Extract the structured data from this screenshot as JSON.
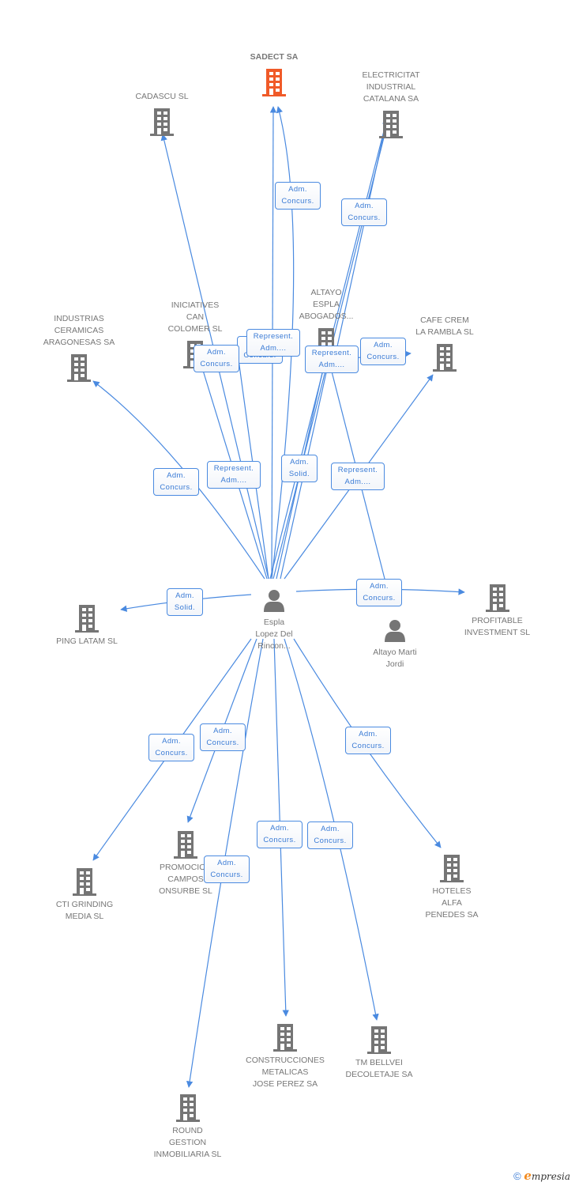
{
  "colors": {
    "edge": "#4a8ae0",
    "main_node": "#f05a28",
    "node": "#757575",
    "edge_text": "#3a7bd5",
    "text": "#777777"
  },
  "main_node": {
    "label": "SADECT SA",
    "icon": "building-icon"
  },
  "nodes": [
    {
      "id": "cadascu",
      "label": "CADASCU SL",
      "type": "company"
    },
    {
      "id": "electricitat",
      "label": "ELECTRICITAT\nINDUSTRIAL\nCATALANA SA",
      "type": "company"
    },
    {
      "id": "industrias",
      "label": "INDUSTRIAS\nCERAMICAS\nARAGONESAS SA",
      "type": "company"
    },
    {
      "id": "iniciatives",
      "label": "INICIATIVES\nCAN\nCOLOMER SL",
      "type": "company"
    },
    {
      "id": "altayo_espla",
      "label": "ALTAYO\nESPLA\nABOGADOS...",
      "type": "company"
    },
    {
      "id": "cafe_crem",
      "label": "CAFE CREM\nLA RAMBLA SL",
      "type": "company"
    },
    {
      "id": "ping_latam",
      "label": "PING LATAM SL",
      "type": "company"
    },
    {
      "id": "espla_lopez",
      "label": "Espla\nLopez Del\nRincon...",
      "type": "person"
    },
    {
      "id": "altayo_marti",
      "label": "Altayo Marti\nJordi",
      "type": "person"
    },
    {
      "id": "profitable",
      "label": "PROFITABLE\nINVESTMENT SL",
      "type": "company"
    },
    {
      "id": "cti",
      "label": "CTI GRINDING\nMEDIA SL",
      "type": "company"
    },
    {
      "id": "promocion",
      "label": "PROMOCION\nCAMPOS\nONSURBE SL",
      "type": "company"
    },
    {
      "id": "hoteles",
      "label": "HOTELES\nALFA\nPENEDES SA",
      "type": "company"
    },
    {
      "id": "construcciones",
      "label": "CONSTRUCCIONES\nMETALICAS\nJOSE PEREZ SA",
      "type": "company"
    },
    {
      "id": "tm_bellvei",
      "label": "TM BELLVEI\nDECOLETAJE SA",
      "type": "company"
    },
    {
      "id": "round",
      "label": "ROUND\nGESTION\nINMOBILIARIA SL",
      "type": "company"
    }
  ],
  "edge_labels": [
    "Adm.\nConcurs.",
    "Adm.\nConcurs.",
    "Adm.\nConcurs.",
    "Represent.\nAdm....",
    "Adm.\nConcurs.",
    "Represent.\nAdm....",
    "Adm.\nConcurs.",
    "Adm.\nConcurs.",
    "Represent.\nAdm....",
    "Adm.\nSolid.",
    "Represent.\nAdm....",
    "Adm.\nSolid.",
    "Adm.\nConcurs.",
    "Adm.\nConcurs.",
    "Adm.\nConcurs.",
    "Adm.\nConcurs.",
    "Adm.\nConcurs.",
    "Adm.\nConcurs.",
    "Adm.\nConcurs."
  ],
  "footer": {
    "copyright": "©",
    "brand_initial": "e",
    "brand_rest": "mpresia"
  }
}
